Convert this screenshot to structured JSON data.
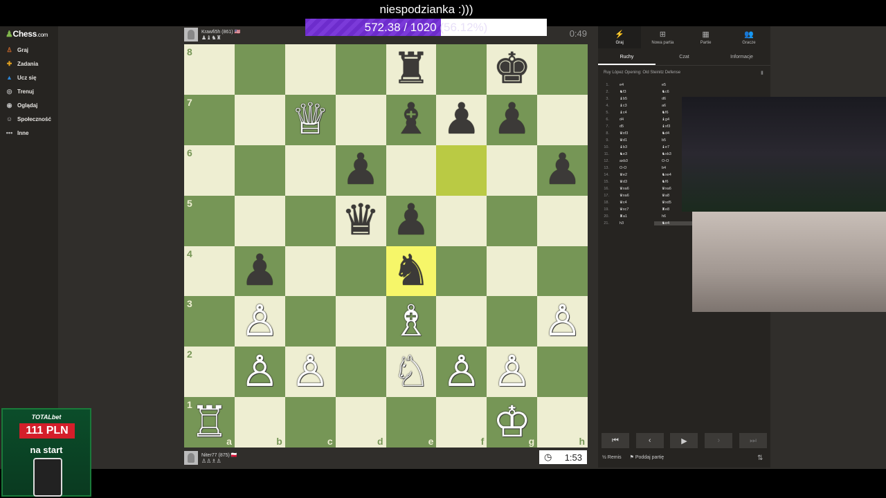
{
  "stream": {
    "title": "niespodzianka :)))",
    "progress_label": "572.38 / 1020",
    "progress_pct_label": "(56.12%)",
    "progress_fraction": 0.5612
  },
  "sidebar": {
    "logo": "Chess",
    "logo_suffix": ".com",
    "items": [
      {
        "icon": "pawn-icon",
        "label": "Graj"
      },
      {
        "icon": "puzzle-icon",
        "label": "Zadania"
      },
      {
        "icon": "graduation-icon",
        "label": "Ucz się"
      },
      {
        "icon": "target-icon",
        "label": "Trenuj"
      },
      {
        "icon": "binoculars-icon",
        "label": "Oglądaj"
      },
      {
        "icon": "community-icon",
        "label": "Społeczność"
      },
      {
        "icon": "more-icon",
        "label": "Inne"
      }
    ]
  },
  "top_player": {
    "name": "Krawfi5h (861)",
    "flag": "🇺🇸",
    "captures": "♟♝♞♜",
    "clock": "0:49"
  },
  "bottom_player": {
    "name": "Niter77 (875)",
    "flag": "🇵🇱",
    "captures": "♙♙♗♙",
    "clock": "1:53"
  },
  "board": {
    "ranks": [
      "8",
      "7",
      "6",
      "5",
      "4",
      "3",
      "2",
      "1"
    ],
    "files": [
      "a",
      "b",
      "c",
      "d",
      "e",
      "f",
      "g",
      "h"
    ],
    "pieces": [
      [
        "",
        "",
        "",
        "",
        "♜",
        "",
        "♚",
        ""
      ],
      [
        "",
        "",
        "♕",
        "",
        "♝",
        "♟",
        "♟",
        ""
      ],
      [
        "",
        "",
        "",
        "♟",
        "",
        "",
        "",
        "♟"
      ],
      [
        "",
        "",
        "",
        "♛",
        "♟",
        "",
        "",
        ""
      ],
      [
        "",
        "♟",
        "",
        "",
        "♞",
        "",
        "",
        ""
      ],
      [
        "",
        "♙",
        "",
        "",
        "♗",
        "",
        "",
        "♙"
      ],
      [
        "",
        "♙",
        "♙",
        "",
        "♘",
        "♙",
        "♙",
        ""
      ],
      [
        "♖",
        "",
        "",
        "",
        "",
        "",
        "♔",
        ""
      ]
    ],
    "highlights": [
      "f6",
      "e4"
    ]
  },
  "panel": {
    "tabs": [
      {
        "icon": "bolt-icon",
        "label": "Graj"
      },
      {
        "icon": "plus-icon",
        "label": "Nowa partia"
      },
      {
        "icon": "board-icon",
        "label": "Partie"
      },
      {
        "icon": "players-icon",
        "label": "Gracze"
      }
    ],
    "subtabs": [
      "Ruchy",
      "Czat",
      "Informacje"
    ],
    "opening": "Ruy López Opening: Old Steinitz Defense",
    "moves": [
      [
        "e4",
        "e5"
      ],
      [
        "♞f3",
        "♞c6"
      ],
      [
        "♝b5",
        "d6"
      ],
      [
        "♝c3",
        "a6"
      ],
      [
        "♝c4",
        "♞f6"
      ],
      [
        "d4",
        "♝g4"
      ],
      [
        "d5",
        "♝xf3"
      ],
      [
        "♛xf3",
        "♞d4"
      ],
      [
        "♛d1",
        "b5"
      ],
      [
        "♝b3",
        "♝e7"
      ],
      [
        "♞e3",
        "♞xb3"
      ],
      [
        "axb3",
        "O-O"
      ],
      [
        "O-O",
        "b4"
      ],
      [
        "♛e2",
        "♞xe4"
      ],
      [
        "♛d3",
        "♞f6"
      ],
      [
        "♛xa6",
        "♛xa6"
      ],
      [
        "♛xa6",
        "♛a8"
      ],
      [
        "♛c4",
        "♛xd5"
      ],
      [
        "♛xc7",
        "♜e8"
      ],
      [
        "♜a1",
        "h6"
      ],
      [
        "h3",
        "♞e4"
      ]
    ],
    "nav": [
      "⏮",
      "‹",
      "▶",
      "›",
      "⏭"
    ],
    "draw_label": "Remis",
    "draw_icon": "½",
    "resign_label": "Poddaj partię"
  },
  "promo": {
    "brand": "TOTALbet",
    "amount": "111 PLN",
    "sub": "na start"
  }
}
